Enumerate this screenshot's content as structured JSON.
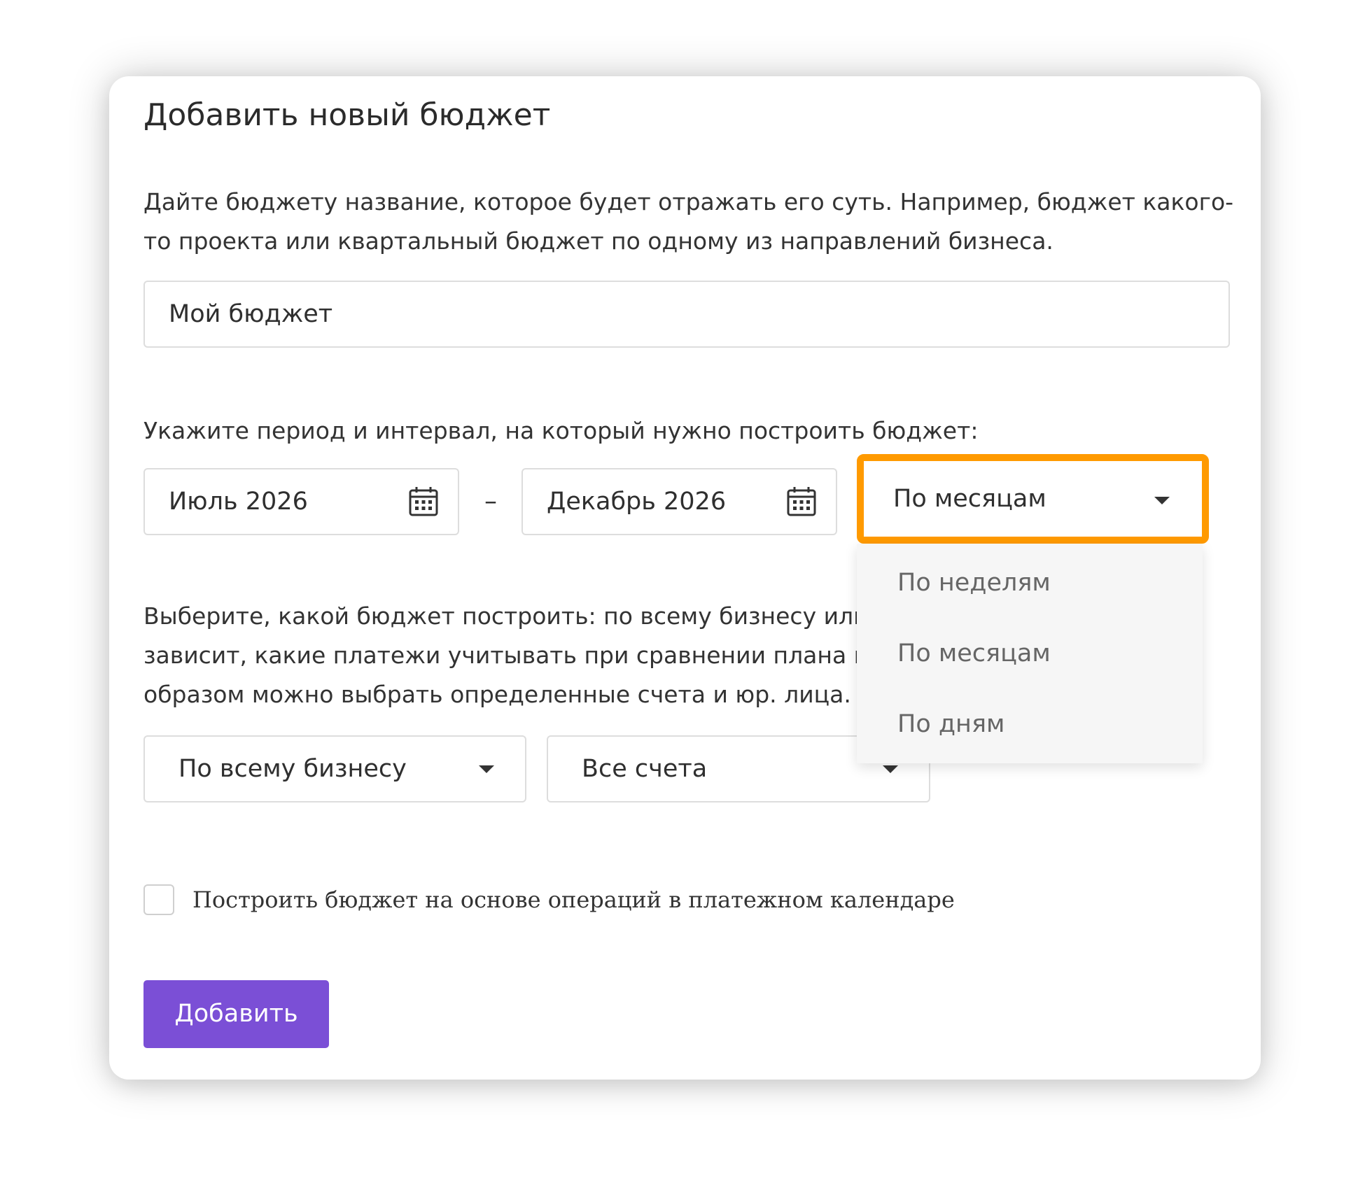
{
  "form": {
    "title": "Добавить новый бюджет",
    "name_hint": "Дайте бюджету название, которое будет отражать его суть. Например, бюджет какого-то проекта или квартальный бюджет по одному из направлений бизнеса.",
    "name_value": "Мой бюджет",
    "period_hint": "Укажите период и интервал, на который нужно построить бюджет:",
    "date_from": "Июль 2026",
    "date_separator": "–",
    "date_to": "Декабрь 2026",
    "interval_selected": "По месяцам",
    "interval_options": [
      "По неделям",
      "По месяцам",
      "По дням"
    ],
    "scope_hint": "Выберите, какой бюджет построить: по всему бизнесу или по проекту. От этого зависит, какие платежи учитывать при сравнении плана и факта. Аналогичным образом можно выбрать определенные счета и юр. лица.",
    "scope_selected": "По всему бизнесу",
    "accounts_selected": "Все счета",
    "calendar_checkbox_label": "Построить бюджет на основе операций в платежном календаре",
    "calendar_checkbox_checked": false,
    "submit_label": "Добавить"
  },
  "colors": {
    "highlight": "#ff9a00",
    "primary_button": "#7b4fd6"
  },
  "icons": {
    "date_picker": "calendar-icon",
    "select_arrow": "caret-down-icon"
  }
}
